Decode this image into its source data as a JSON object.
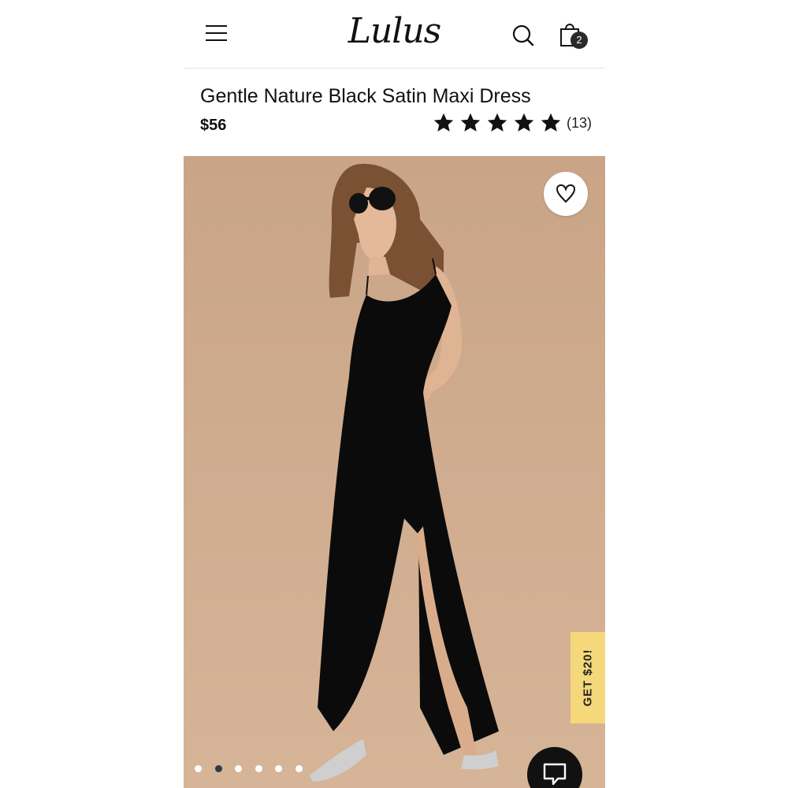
{
  "header": {
    "logo_text": "Lulus",
    "menu_icon": "hamburger-menu-icon",
    "search_icon": "search-icon",
    "bag_icon": "shopping-bag-icon",
    "bag_count": "2"
  },
  "product": {
    "title": "Gentle Nature Black Satin Maxi Dress",
    "price": "$56",
    "rating_stars": 5,
    "review_count": "(13)"
  },
  "gallery": {
    "image_count": 6,
    "active_index": 1,
    "favorite_icon": "heart-icon",
    "chat_icon": "chat-bubble-icon"
  },
  "promo": {
    "label": "GET $20!"
  },
  "colors": {
    "promo_tab": "#f4d87a",
    "background": "#cba78a",
    "active_dot": "#2d3a4a"
  }
}
